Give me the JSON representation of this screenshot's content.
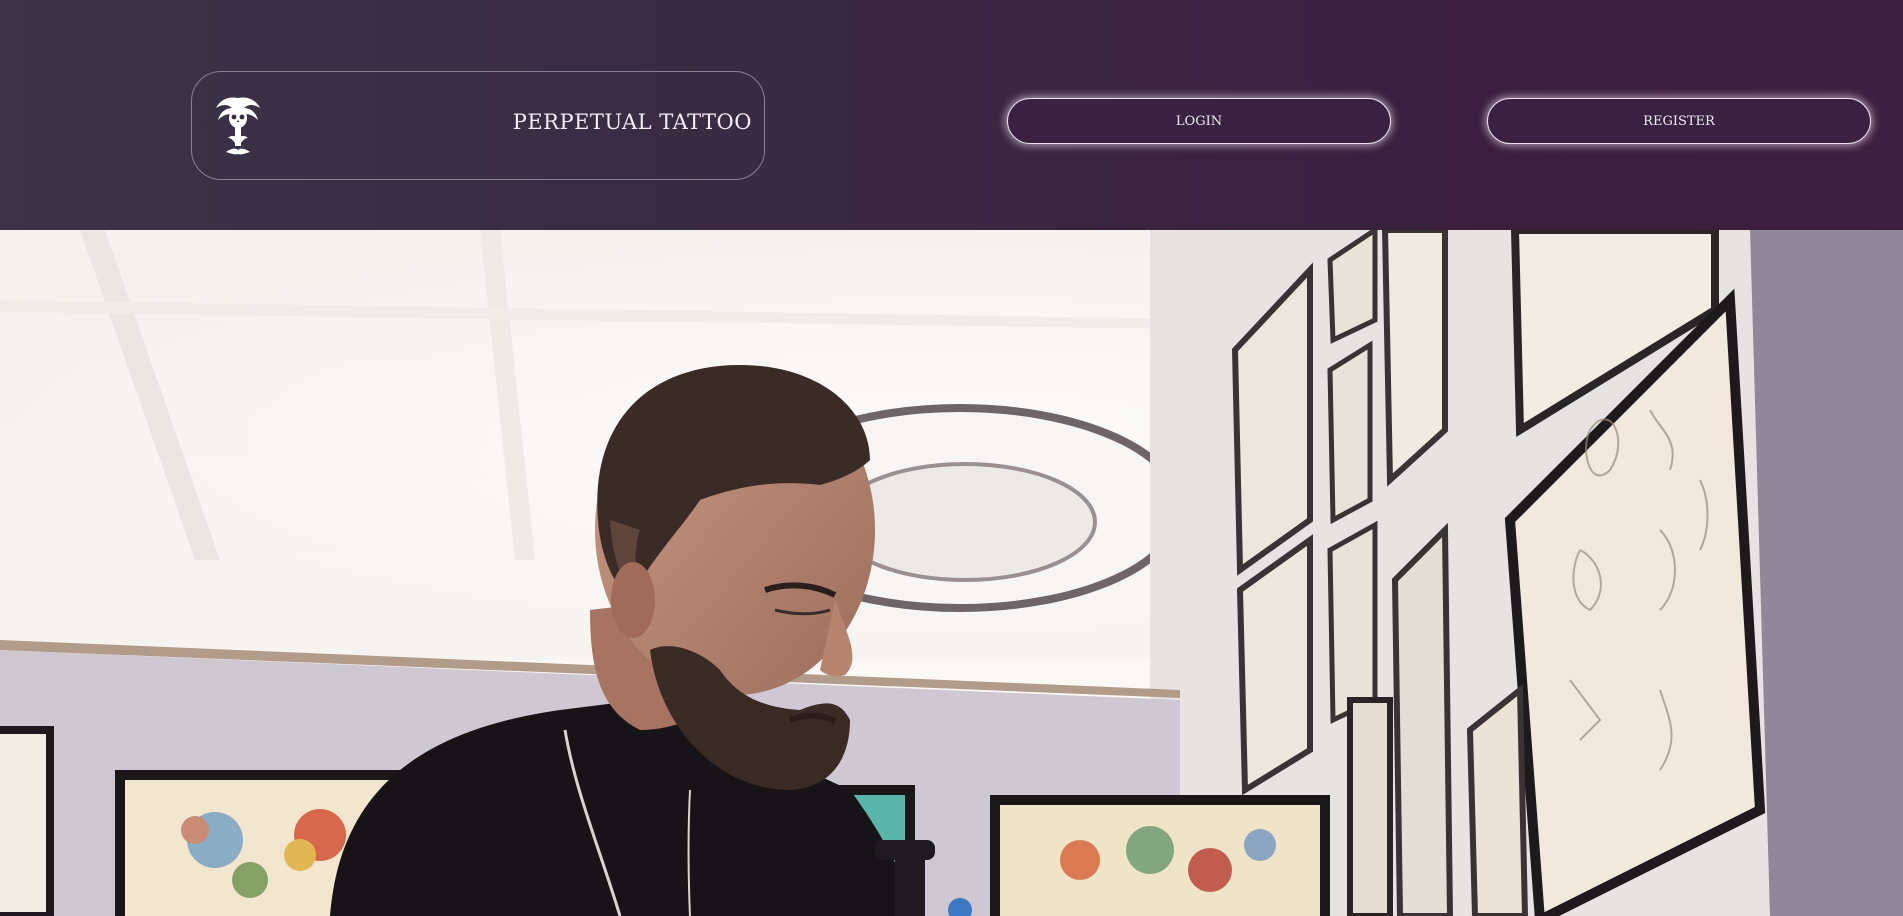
{
  "header": {
    "brand_name": "PERPETUAL TATTOO",
    "logo_icon": "palm-skull-logo-icon",
    "nav": {
      "login_label": "LOGIN",
      "register_label": "REGISTER"
    }
  },
  "hero": {
    "image_subject": "tattoo-artist-at-work-photo"
  },
  "colors": {
    "header_bg": "#3a2442",
    "button_border": "#ece2ee",
    "text": "#f3eef5"
  }
}
